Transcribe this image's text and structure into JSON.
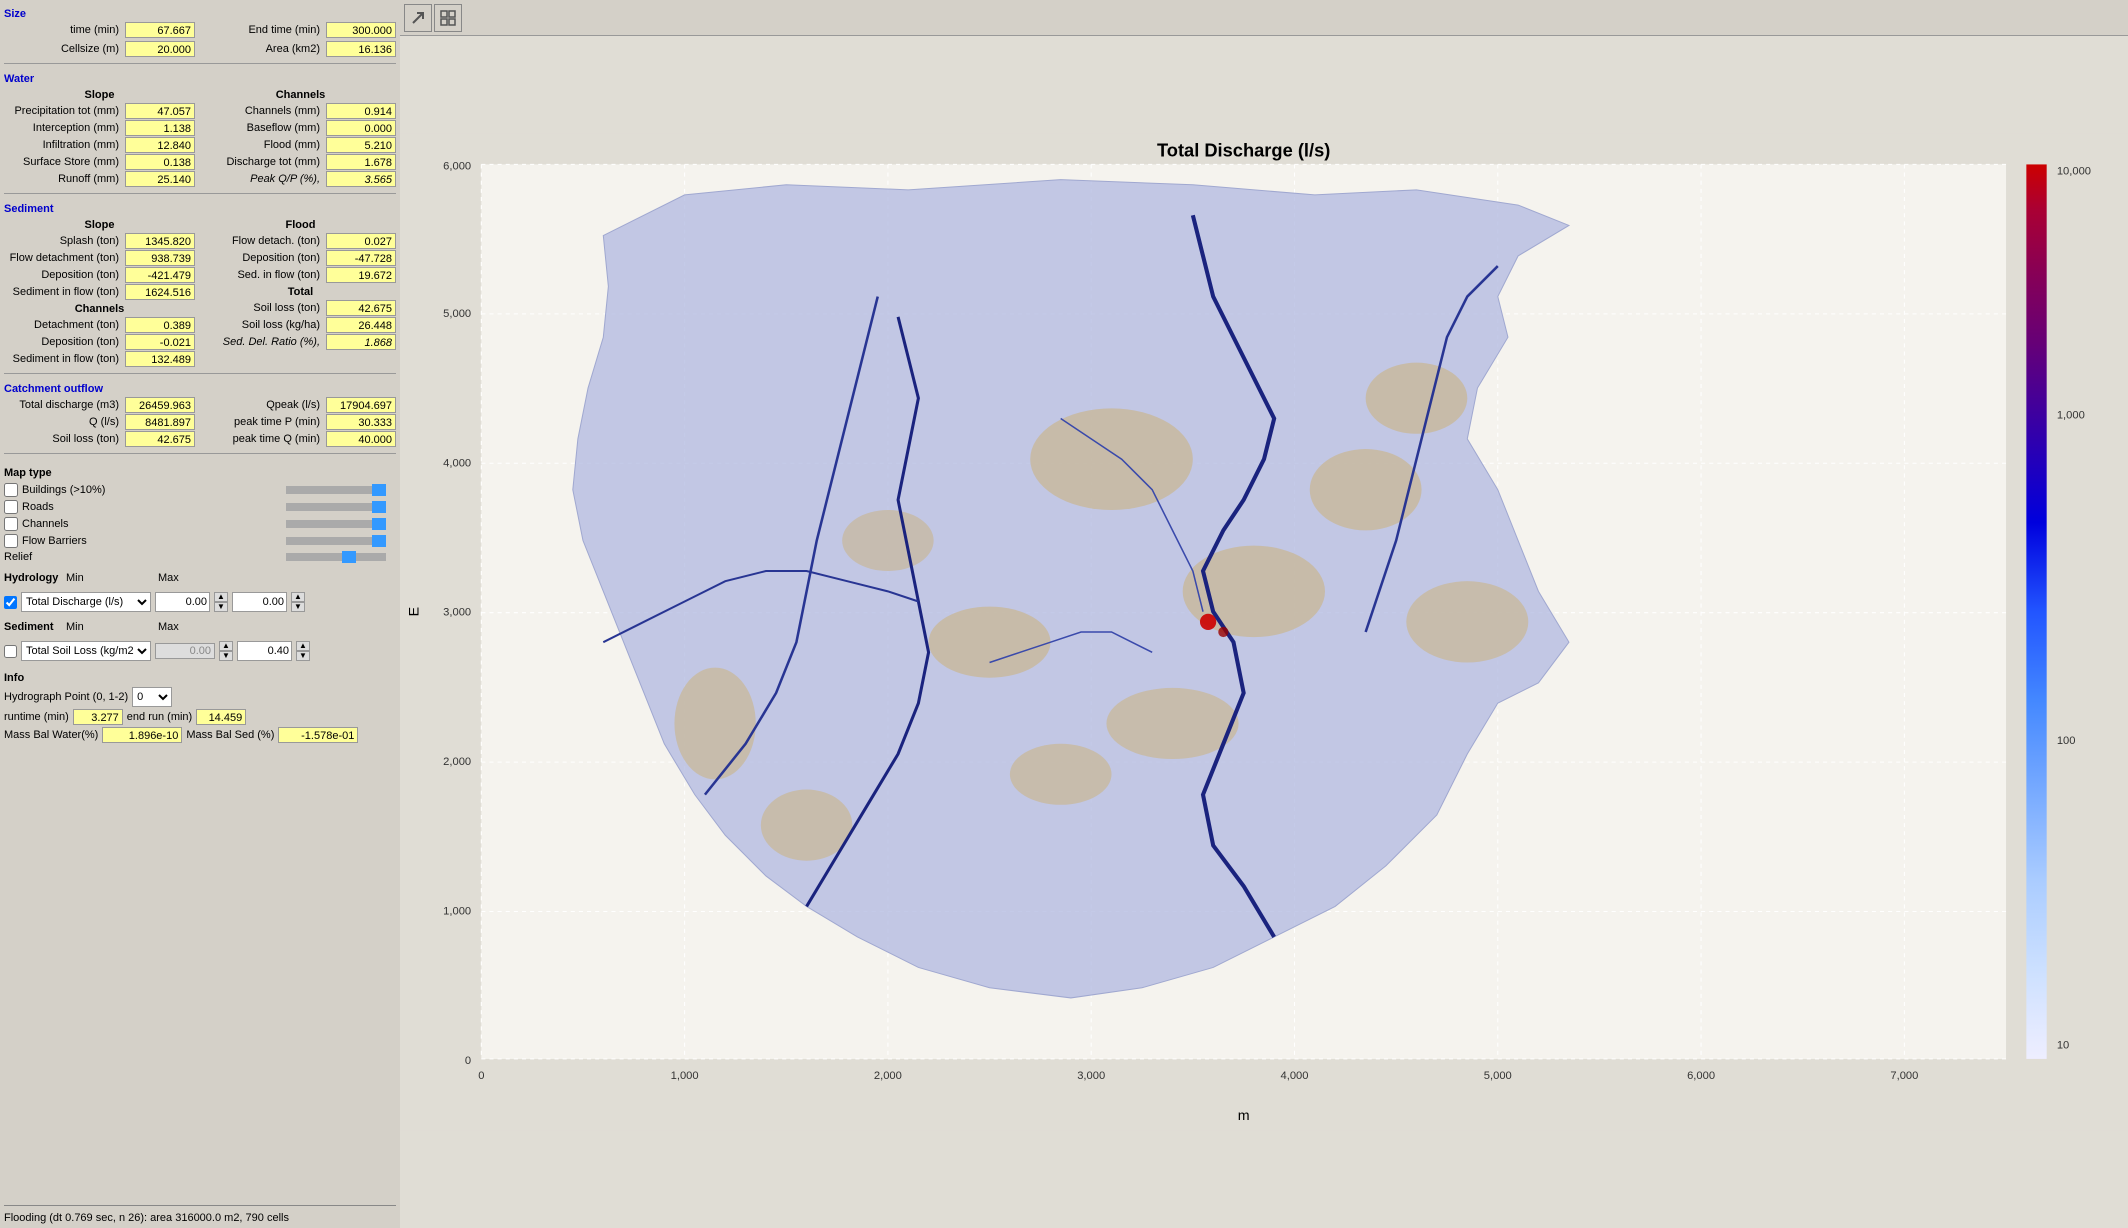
{
  "size": {
    "title": "Size",
    "time_label": "time (min)",
    "time_value": "67.667",
    "end_time_label": "End time (min)",
    "end_time_value": "300.000",
    "cellsize_label": "Cellsize (m)",
    "cellsize_value": "20.000",
    "area_label": "Area (km2)",
    "area_value": "16.136"
  },
  "water": {
    "title": "Water",
    "slope_title": "Slope",
    "channels_title": "Channels",
    "slope": {
      "precip_label": "Precipitation tot (mm)",
      "precip_value": "47.057",
      "interception_label": "Interception (mm)",
      "interception_value": "1.138",
      "infiltration_label": "Infiltration (mm)",
      "infiltration_value": "12.840",
      "surface_store_label": "Surface Store (mm)",
      "surface_store_value": "0.138",
      "runoff_label": "Runoff (mm)",
      "runoff_value": "25.140"
    },
    "channels": {
      "channels_label": "Channels (mm)",
      "channels_value": "0.914",
      "baseflow_label": "Baseflow (mm)",
      "baseflow_value": "0.000",
      "flood_label": "Flood (mm)",
      "flood_value": "5.210",
      "discharge_tot_label": "Discharge tot (mm)",
      "discharge_tot_value": "1.678",
      "peak_qp_label": "Peak Q/P (%),",
      "peak_qp_value": "3.565"
    }
  },
  "sediment": {
    "title": "Sediment",
    "slope_title": "Slope",
    "flood_title": "Flood",
    "total_title": "Total",
    "channels_title": "Channels",
    "slope": {
      "splash_label": "Splash (ton)",
      "splash_value": "1345.820",
      "flow_detach_label": "Flow detachment (ton)",
      "flow_detach_value": "938.739",
      "deposition_label": "Deposition (ton)",
      "deposition_value": "-421.479",
      "sed_in_flow_label": "Sediment in flow (ton)",
      "sed_in_flow_value": "1624.516"
    },
    "flood": {
      "flow_detach_label": "Flow detach. (ton)",
      "flow_detach_value": "0.027",
      "deposition_label": "Deposition (ton)",
      "deposition_value": "-47.728",
      "sed_in_flow_label": "Sed. in flow (ton)",
      "sed_in_flow_value": "19.672"
    },
    "channels": {
      "detachment_label": "Detachment (ton)",
      "detachment_value": "0.389",
      "deposition_label": "Deposition (ton)",
      "deposition_value": "-0.021",
      "sed_in_flow_label": "Sediment in flow (ton)",
      "sed_in_flow_value": "132.489"
    },
    "total": {
      "soil_loss_ton_label": "Soil loss (ton)",
      "soil_loss_ton_value": "42.675",
      "soil_loss_kgha_label": "Soil loss (kg/ha)",
      "soil_loss_kgha_value": "26.448",
      "sed_del_ratio_label": "Sed. Del. Ratio (%),",
      "sed_del_ratio_value": "1.868"
    }
  },
  "catchment": {
    "title": "Catchment outflow",
    "total_discharge_label": "Total discharge (m3)",
    "total_discharge_value": "26459.963",
    "q_ls_label": "Q (l/s)",
    "q_ls_value": "8481.897",
    "soil_loss_label": "Soil loss (ton)",
    "soil_loss_value": "42.675",
    "qpeak_label": "Qpeak (l/s)",
    "qpeak_value": "17904.697",
    "peak_time_p_label": "peak time P (min)",
    "peak_time_p_value": "30.333",
    "peak_time_q_label": "peak time Q (min)",
    "peak_time_q_value": "40.000"
  },
  "map_type": {
    "title": "Map type",
    "buildings_label": "Buildings (>10%)",
    "roads_label": "Roads",
    "channels_label": "Channels",
    "flow_barriers_label": "Flow Barriers",
    "relief_label": "Relief"
  },
  "hydrology": {
    "title": "Hydrology",
    "checked": true,
    "dropdown_value": "Total Discharge (l/s)",
    "min_label": "Min",
    "min_value": "0.00",
    "max_label": "Max",
    "max_value": "0.00"
  },
  "sediment_map": {
    "title": "Sediment",
    "checked": false,
    "dropdown_value": "Total Soil Loss (kg/m2",
    "min_label": "Min",
    "min_value": "0.00",
    "max_label": "Max",
    "max_value": "0.40"
  },
  "info": {
    "title": "Info",
    "hydro_point_label": "Hydrograph Point (0, 1-2)",
    "hydro_point_value": "0",
    "runtime_label": "runtime (min)",
    "runtime_value": "3.277",
    "end_run_label": "end run (min)",
    "end_run_value": "14.459",
    "mass_bal_water_label": "Mass Bal Water(%)",
    "mass_bal_water_value": "1.896e-10",
    "mass_bal_sed_label": "Mass Bal Sed (%)",
    "mass_bal_sed_value": "-1.578e-01"
  },
  "status_bar": {
    "text": "Flooding (dt 0.769 sec, n  26): area 316000.0 m2, 790 cells"
  },
  "toolbar": {
    "icon1": "↗",
    "icon2": "⊞"
  },
  "map": {
    "title": "Total Discharge (l/s)",
    "x_label": "m",
    "y_label": "E",
    "x_ticks": [
      "0",
      "1,000",
      "2,000",
      "3,000",
      "4,000",
      "5,000",
      "6,000",
      "7,000"
    ],
    "y_ticks": [
      "0",
      "1,000",
      "2,000",
      "3,000",
      "4,000",
      "5,000",
      "6,000"
    ],
    "legend_values": [
      "10,000",
      "1,000",
      "100",
      "10"
    ]
  }
}
